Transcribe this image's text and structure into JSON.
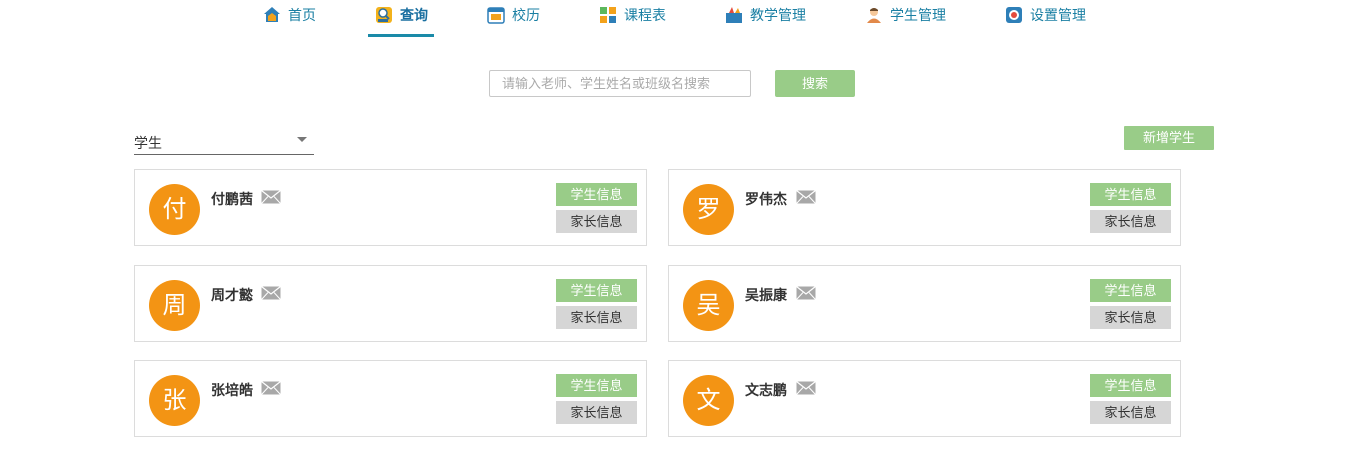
{
  "nav": {
    "items": [
      {
        "label": "首页",
        "icon": "home-icon"
      },
      {
        "label": "查询",
        "icon": "search-user-icon",
        "active": true
      },
      {
        "label": "校历",
        "icon": "calendar-icon"
      },
      {
        "label": "课程表",
        "icon": "timetable-icon"
      },
      {
        "label": "教学管理",
        "icon": "teaching-icon"
      },
      {
        "label": "学生管理",
        "icon": "student-icon"
      },
      {
        "label": "设置管理",
        "icon": "settings-icon"
      }
    ]
  },
  "search": {
    "placeholder": "请输入老师、学生姓名或班级名搜索",
    "value": "",
    "button_label": "搜索"
  },
  "filter": {
    "role_selected": "学生"
  },
  "add_button_label": "新增学生",
  "students": [
    {
      "avatar_char": "付",
      "name": "付鹏茜"
    },
    {
      "avatar_char": "罗",
      "name": "罗伟杰"
    },
    {
      "avatar_char": "周",
      "name": "周才懿"
    },
    {
      "avatar_char": "吴",
      "name": "吴振康"
    },
    {
      "avatar_char": "张",
      "name": "张培皓"
    },
    {
      "avatar_char": "文",
      "name": "文志鹏"
    }
  ],
  "card_buttons": {
    "student_info": "学生信息",
    "parent_info": "家长信息"
  },
  "colors": {
    "accent_green": "#99cc88",
    "avatar_orange": "#f39414",
    "nav_text": "#1a7fa3",
    "active_underline": "#1a8aa8"
  }
}
